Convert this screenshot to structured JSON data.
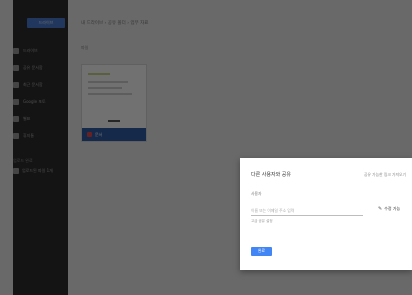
{
  "sidebar": {
    "logo_label": "드라이브",
    "items": [
      {
        "label": "드라이브",
        "icon": "drive-icon"
      },
      {
        "label": "공유 문서함",
        "icon": "shared-icon"
      },
      {
        "label": "최근 문서함",
        "icon": "recent-icon"
      },
      {
        "label": "Google 포토",
        "icon": "photos-icon"
      },
      {
        "label": "별표",
        "icon": "star-icon"
      },
      {
        "label": "휴지통",
        "icon": "trash-icon"
      }
    ],
    "section_label": "업로드 완료",
    "file_label": "업로드된 파일 1개",
    "file_icon": "file-icon"
  },
  "main": {
    "breadcrumb": "내 드라이브 › 공유 폴더 › 업무 자료",
    "section_label": "파일",
    "file_card": {
      "name": "문서",
      "type_icon": "pdf-icon",
      "accent": "#2f5da7"
    }
  },
  "dialog": {
    "title": "다른 사용자와 공유",
    "hint": "공유 가능한 링크 가져오기",
    "field_label": "사용자",
    "input_placeholder": "이름 또는 이메일 주소 입력",
    "helper": "고급 공유 설정",
    "edit_action": "수정 가능",
    "done_button": "완료",
    "accent": "#4285f4"
  }
}
